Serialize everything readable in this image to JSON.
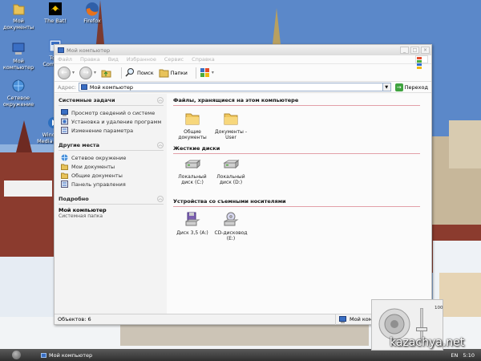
{
  "desktop": {
    "icons": [
      {
        "label": "Мой документы",
        "icon": "folder-documents-icon"
      },
      {
        "label": "The Bat!",
        "icon": "the-bat-icon"
      },
      {
        "label": "Firefox",
        "icon": "firefox-icon"
      },
      {
        "label": "Мой компьютер",
        "icon": "computer-icon"
      },
      {
        "label": "Total Comma...",
        "icon": "total-commander-icon"
      },
      {
        "label": "Сетевое окружение",
        "icon": "network-icon"
      },
      {
        "label": "Windows Media Player",
        "icon": "media-player-icon"
      }
    ]
  },
  "window": {
    "title": "Мой компьютер",
    "menu": [
      "Файл",
      "Правка",
      "Вид",
      "Избранное",
      "Сервис",
      "Справка"
    ],
    "toolbar": {
      "back_label": "Назад",
      "search_label": "Поиск",
      "folders_label": "Папки"
    },
    "address": {
      "label": "Адрес:",
      "value": "Мой компьютер",
      "go_label": "Переход"
    },
    "left_pane": {
      "system_tasks": {
        "title": "Системные задачи",
        "items": [
          {
            "label": "Просмотр сведений о системе",
            "icon": "system-info-icon"
          },
          {
            "label": "Установка и удаление программ",
            "icon": "add-remove-programs-icon"
          },
          {
            "label": "Изменение параметра",
            "icon": "control-panel-icon"
          }
        ]
      },
      "other_places": {
        "title": "Другие места",
        "items": [
          {
            "label": "Сетевое окружение",
            "icon": "network-icon"
          },
          {
            "label": "Мои документы",
            "icon": "folder-icon"
          },
          {
            "label": "Общие документы",
            "icon": "folder-icon"
          },
          {
            "label": "Панель управления",
            "icon": "control-panel-icon"
          }
        ]
      },
      "details": {
        "title": "Подробно",
        "name": "Мой компьютер",
        "type": "Системная папка"
      }
    },
    "groups": [
      {
        "title": "Файлы, хранящиеся на этом компьютере",
        "items": [
          {
            "label_line1": "Общие",
            "label_line2": "документы",
            "icon": "folder-icon"
          },
          {
            "label_line1": "Документы -",
            "label_line2": "User",
            "icon": "folder-icon"
          }
        ]
      },
      {
        "title": "Жесткие диски",
        "items": [
          {
            "label_line1": "Локальный",
            "label_line2": "диск (C:)",
            "icon": "hard-drive-icon"
          },
          {
            "label_line1": "Локальный",
            "label_line2": "диск (D:)",
            "icon": "hard-drive-icon"
          }
        ]
      },
      {
        "title": "Устройства со съемными носителями",
        "items": [
          {
            "label_line1": "Диск 3,5 (A:)",
            "label_line2": "",
            "icon": "floppy-drive-icon"
          },
          {
            "label_line1": "CD-дисковод",
            "label_line2": "(E:)",
            "icon": "cd-drive-icon"
          }
        ]
      }
    ],
    "status": {
      "objects": "Объектов: 6",
      "location": "Мой компьютер"
    }
  },
  "taskbar": {
    "task": "Мой компьютер",
    "lang": "EN",
    "clock": "5:10"
  },
  "volume": {
    "max_label": "100",
    "level": 0.4
  },
  "watermark": "kazachya.net",
  "colors": {
    "accent": "#3a6fc4",
    "group_underline": "#e2a0a8",
    "go_green": "#3fa33f"
  }
}
